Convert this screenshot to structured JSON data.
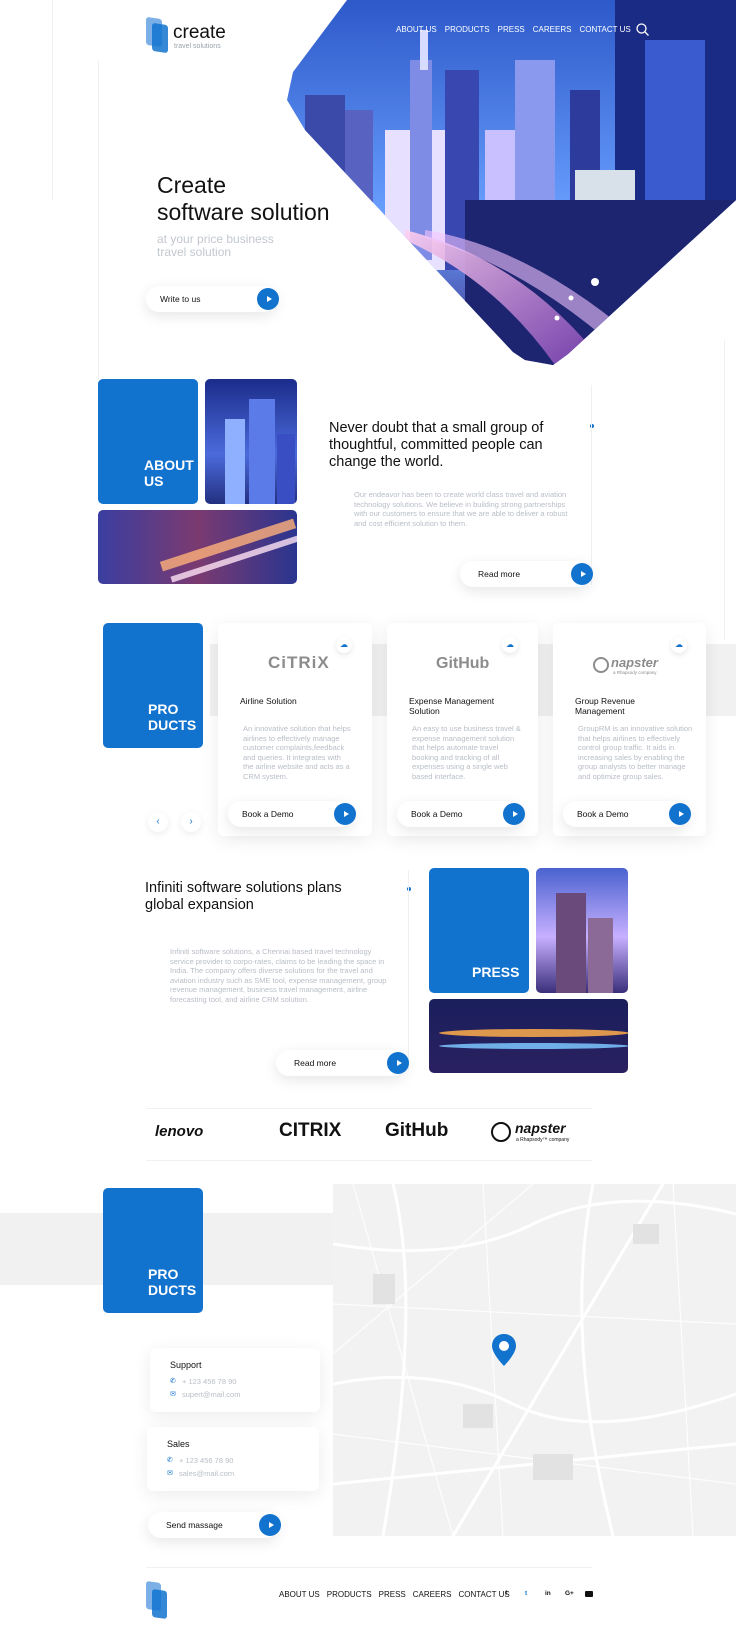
{
  "brand": {
    "name": "create",
    "tagline": "travel solutions"
  },
  "nav": [
    "ABOUT US",
    "PRODUCTS",
    "PRESS",
    "CAREERS",
    "CONTACT US"
  ],
  "hero": {
    "title_line1": "Create",
    "title_line2": "software solution",
    "subtitle_line1": "at your price business",
    "subtitle_line2": "travel solution",
    "cta": "Write to us"
  },
  "about": {
    "block": "ABOUT US",
    "headline": "Never doubt that a small group of thoughtful, committed people can change the world.",
    "body": "Our endeavor has been to create world class travel and aviation technology solutions. We believe in building strong partnerships with our customers to ensure that we are able to deliver a robust and cost efficient solution to them.",
    "cta": "Read more"
  },
  "products": {
    "block": "PRO DUCTS",
    "cards": [
      {
        "logo": "CiTRiX",
        "title": "Airline Solution",
        "desc": "An innovative solution that helps airlines to effectively manage customer complaints,feedback and queries. It integrates with the airline website and acts as a CRM system.",
        "cta": "Book a Demo"
      },
      {
        "logo": "GitHub",
        "title": "Expense Management Solution",
        "desc": "An easy to use business travel & expense management solution that helps automate travel booking and tracking of all expenses using a single web based interface.",
        "cta": "Book a Demo"
      },
      {
        "logo": "napster",
        "logo_sub": "a Rhapsody company",
        "title": "Group Revenue Management",
        "desc": "GroupRM is an innovative solution that helps airlines to effectively control group traffic. It aids in increasing sales by enabling the group analysts to better manage and optimize group sales.",
        "cta": "Book a Demo"
      }
    ]
  },
  "press": {
    "block": "PRESS",
    "headline": "Infiniti software solutions plans global expansion",
    "body": "Infiniti software solutions, a Chennai based travel technology service provider to corpo-rates, claims to be leading the space in India. The company offers diverse solutions for the travel and aviation industry such as SME tool, expense management, group revenue management, business travel management, airline forecasting tool, and airline CRM solution.",
    "cta": "Read more"
  },
  "partners": [
    "lenovo",
    "CITRIX",
    "GitHub",
    "napster"
  ],
  "partner_sub": "a Rhapsody™ company",
  "contact": {
    "block": "PRO DUCTS",
    "support": {
      "title": "Support",
      "phone": "+ 123 456 78 90",
      "email": "supert@mail.com"
    },
    "sales": {
      "title": "Sales",
      "phone": "+ 123 456 78 90",
      "email": "sales@mail.com"
    },
    "cta": "Send massage"
  },
  "footer": {
    "nav": [
      "ABOUT US",
      "PRODUCTS",
      "PRESS",
      "CAREERS",
      "CONTACT US"
    ],
    "social": [
      "f",
      "t",
      "in",
      "G+",
      "yt"
    ]
  },
  "colors": {
    "accent": "#1273cf"
  }
}
